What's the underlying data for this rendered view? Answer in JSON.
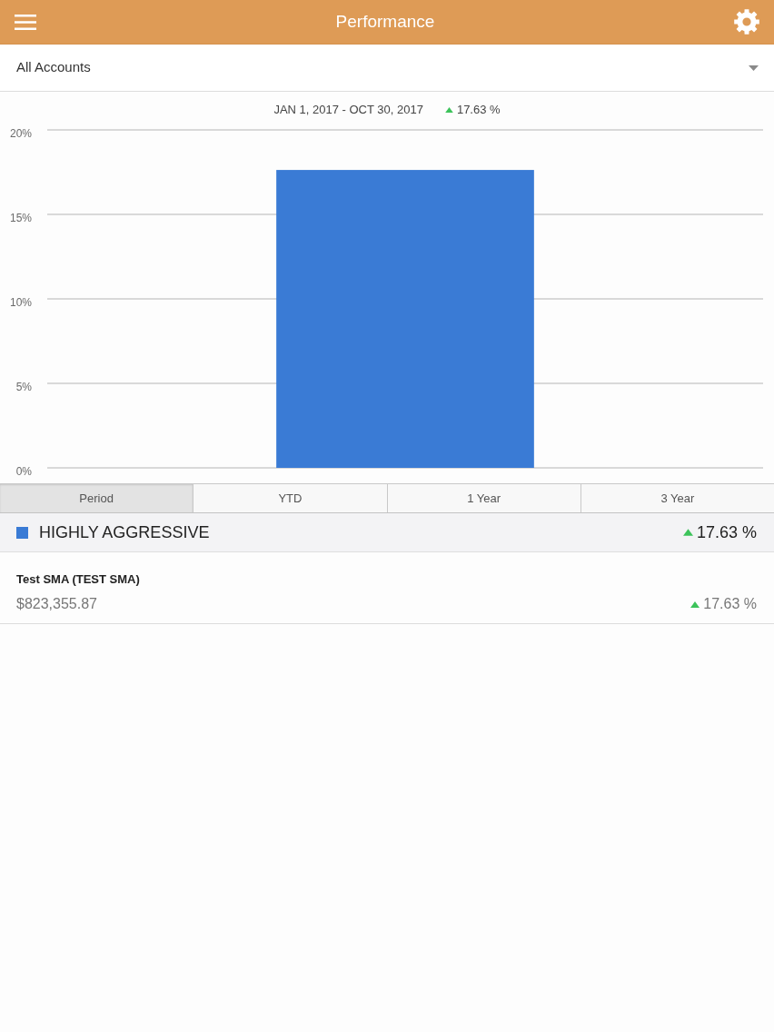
{
  "header": {
    "title": "Performance"
  },
  "account_selector": {
    "value": "All Accounts"
  },
  "chart": {
    "range": "JAN 1, 2017 - OCT 30, 2017",
    "change": "17.63 %",
    "positive": true,
    "chart_data": {
      "type": "bar",
      "grid": true,
      "series": [
        {
          "color": "#3a7bd5",
          "values": [
            17.63
          ]
        }
      ],
      "ylim": [
        0,
        20
      ],
      "yticks": [
        {
          "value": 0,
          "label": "0%"
        },
        {
          "value": 5,
          "label": "5%"
        },
        {
          "value": 10,
          "label": "10%"
        },
        {
          "value": 15,
          "label": "15%"
        },
        {
          "value": 20,
          "label": "20%"
        }
      ]
    }
  },
  "tabs": [
    {
      "label": "Period",
      "selected": true
    },
    {
      "label": "YTD",
      "selected": false
    },
    {
      "label": "1 Year",
      "selected": false
    },
    {
      "label": "3 Year",
      "selected": false
    }
  ],
  "groups": [
    {
      "name": "HIGHLY AGGRESSIVE",
      "color": "#3a7bd5",
      "change": "17.63 %",
      "positive": true,
      "accounts": [
        {
          "name": "Test SMA (TEST SMA)",
          "value": "$823,355.87",
          "change": "17.63 %",
          "positive": true
        }
      ]
    }
  ]
}
